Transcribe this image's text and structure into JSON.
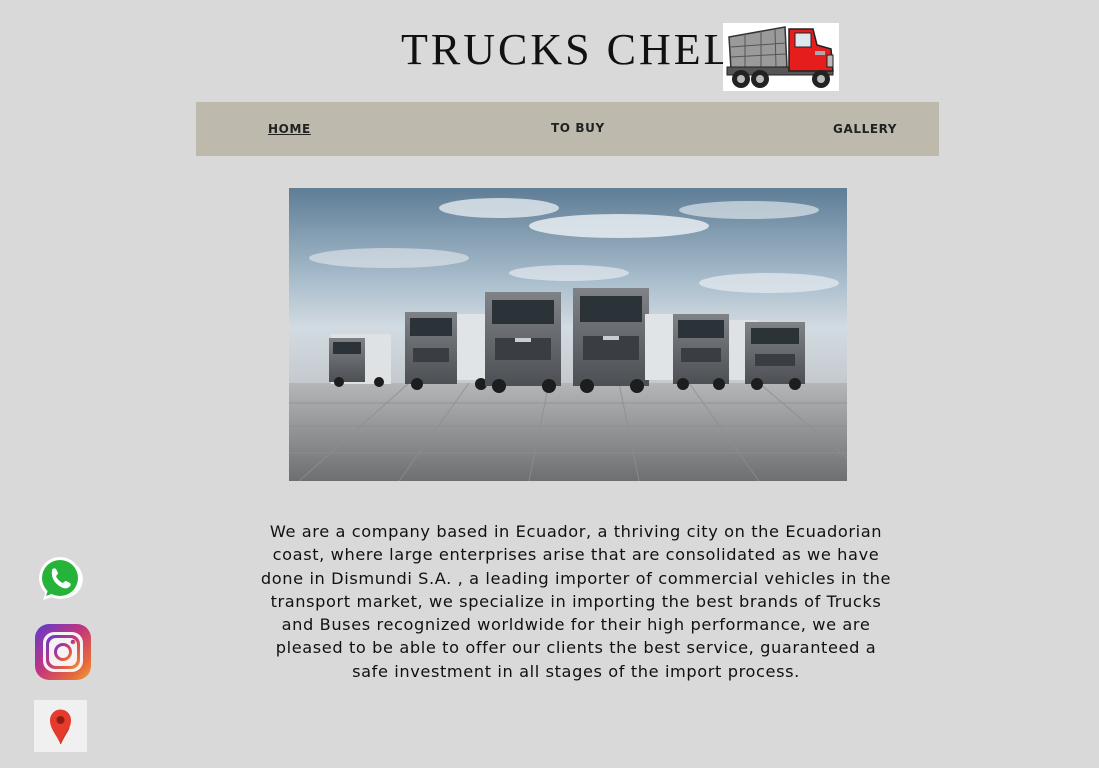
{
  "header": {
    "brand_title": "TRUCKS CHEL"
  },
  "nav": {
    "items": [
      {
        "label": "HOME",
        "active": true
      },
      {
        "label": "TO BUY",
        "active": false
      },
      {
        "label": "GALLERY",
        "active": false
      }
    ]
  },
  "main": {
    "about_text": "We are a company based in Ecuador, a thriving city on the Ecuadorian coast, where large enterprises arise that are consolidated as we have done in Dismundi S.A. , a leading importer of commercial vehicles in the transport market, we specialize in importing the best brands of Trucks and Buses recognized worldwide for their high performance, we are pleased to be able to offer our clients the best service, guaranteed a safe investment in all stages of the import process."
  },
  "social": {
    "icons": [
      "whatsapp-icon",
      "instagram-icon",
      "google-maps-icon"
    ]
  },
  "colors": {
    "page_background": "#d9d9d9",
    "nav_background": "#bdb9ad",
    "whatsapp_green": "#25d366",
    "truck_cab_red": "#e51d1d"
  }
}
